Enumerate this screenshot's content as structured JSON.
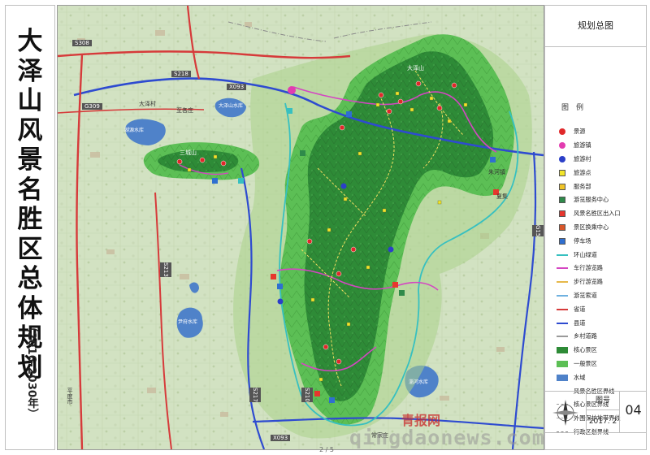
{
  "title_chars": [
    "大",
    "泽",
    "山",
    "风",
    "景",
    "名",
    "胜",
    "区",
    "总",
    "体",
    "规",
    "划"
  ],
  "years": "（2016-2030年）",
  "map_heading": "规划总图",
  "legend_title": "图　例",
  "legend": [
    {
      "label": "景源",
      "symbol": "dot",
      "color": "#e0282a"
    },
    {
      "label": "旅游镇",
      "symbol": "dot",
      "color": "#e23cb0"
    },
    {
      "label": "旅游村",
      "symbol": "dot",
      "color": "#2b3fc8"
    },
    {
      "label": "旅游点",
      "symbol": "square",
      "color": "#f2e52a"
    },
    {
      "label": "服务部",
      "symbol": "square",
      "color": "#f0c428"
    },
    {
      "label": "游览服务中心",
      "symbol": "square",
      "color": "#2f8a4a"
    },
    {
      "label": "风景名胜区出入口",
      "symbol": "square",
      "color": "#e7362e"
    },
    {
      "label": "景区换乘中心",
      "symbol": "square",
      "color": "#d9572a"
    },
    {
      "label": "停车场",
      "symbol": "square",
      "color": "#2f6fd0"
    },
    {
      "label": "环山绿道",
      "symbol": "line",
      "color": "#37c0c0"
    },
    {
      "label": "车行游览路",
      "symbol": "line",
      "color": "#d446c2"
    },
    {
      "label": "步行游览路",
      "symbol": "line",
      "color": "#e6b84a"
    },
    {
      "label": "游览索道",
      "symbol": "line",
      "color": "#6fb1e0"
    },
    {
      "label": "省道",
      "symbol": "line",
      "color": "#d63a3a"
    },
    {
      "label": "县道",
      "symbol": "line",
      "color": "#2e4bd0"
    },
    {
      "label": "乡村道路",
      "symbol": "line",
      "color": "#9a9a9a"
    },
    {
      "label": "核心景区",
      "symbol": "area",
      "color": "#2e8b37"
    },
    {
      "label": "一般景区",
      "symbol": "area",
      "color": "#5cbf55"
    },
    {
      "label": "水域",
      "symbol": "area",
      "color": "#4f82c9"
    },
    {
      "label": "风景名胜区界线",
      "symbol": "boundary",
      "color": "#7a7a7a"
    },
    {
      "label": "核心景区界线",
      "symbol": "boundary",
      "color": "#9a9a9a"
    },
    {
      "label": "外围保护地带界线",
      "symbol": "boundary",
      "color": "#aaaaaa"
    },
    {
      "label": "行政区划界线",
      "symbol": "boundary",
      "color": "#888888"
    }
  ],
  "sheet_label": "图号",
  "sheet_number": "04",
  "date": "2017. 2",
  "watermark_text": "qingdaonews.com",
  "watermark_logo": "青报网",
  "page_indicator": "2 / 5",
  "map_labels": {
    "road_s308": "S308",
    "road_s218": "S218",
    "road_x093_n": "X093",
    "road_x093_s": "X093",
    "road_g309": "G309",
    "road_s217": "S217",
    "road_s213": "S213",
    "road_g15": "G15",
    "road_s210": "S210",
    "town_dazecun": "大泽村",
    "town_zhige": "至各庄",
    "town_zhuhe": "朱河镇",
    "town_chanzhuang": "常家庄",
    "town_xiaji": "夏集",
    "town_pingdu": "平度市",
    "res_yuanshan": "湖源水库",
    "res_dashan": "大泽山水库",
    "res_south": "尹府水库",
    "res_east": "淄河水库",
    "scenic_north": "大泽山",
    "scenic_west": "三城山"
  },
  "colors": {
    "land": "#cfe0bf",
    "plain": "#d6e5c4",
    "general_zone": "#5cbf55",
    "core_zone": "#2e8b37",
    "water": "#4f82c9",
    "county_road": "#2e4bd0",
    "provincial_road": "#d63a3a",
    "greenway": "#37c0c0",
    "scenic_drive": "#d446c2"
  }
}
